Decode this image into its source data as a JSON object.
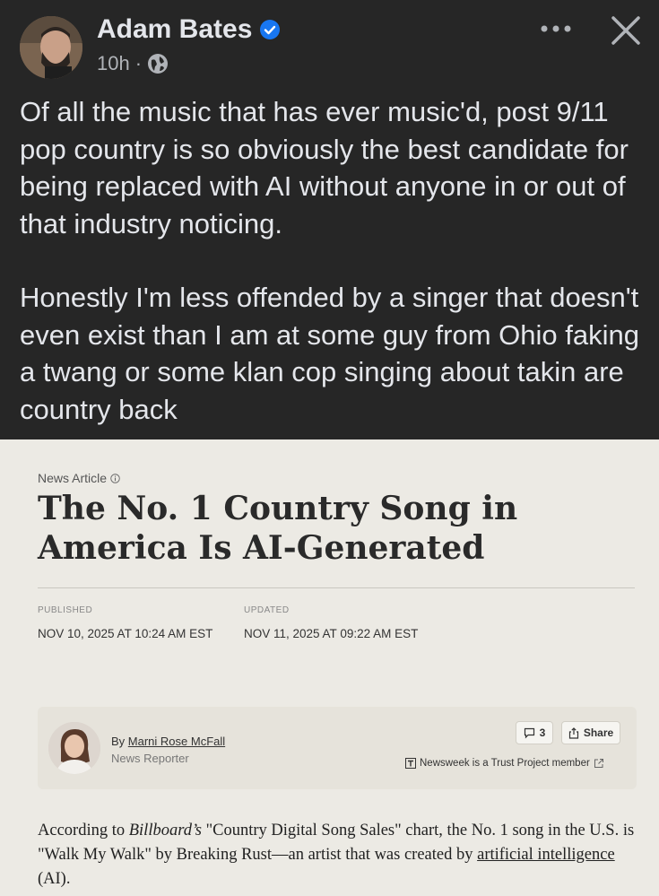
{
  "post": {
    "author": "Adam Bates",
    "time": "10h",
    "separator": "·",
    "paragraphs": [
      "Of all the music that has ever music'd, post 9/11 pop country is so obviously the best candidate for being replaced with AI without anyone in or out of that industry noticing.",
      "Honestly I'm less offended by a singer that doesn't even exist than I am at some guy from Ohio faking a twang or some klan cop singing about takin are country back"
    ],
    "icons": [
      "verified-badge-icon",
      "globe-icon",
      "more-options-icon",
      "close-icon"
    ],
    "colors": {
      "background": "#262626",
      "text": "#e4e6eb",
      "verified": "#1877f2"
    }
  },
  "article": {
    "kicker": "News Article",
    "headline": "The No. 1 Country Song in America Is AI-Generated",
    "published_label": "PUBLISHED",
    "published_date": "NOV 10, 2025 AT 10:24 AM EST",
    "updated_label": "UPDATED",
    "updated_date": "NOV 11, 2025 AT 09:22 AM EST",
    "byline_prefix": "By",
    "author_name": "Marni Rose McFall",
    "author_role": "News Reporter",
    "comment_count": "3",
    "share_label": "Share",
    "trust_text": "Newsweek is a Trust Project member",
    "paragraph": {
      "p1": "According to ",
      "source": "Billboard’s",
      "p2": " \"Country Digital Song Sales\" chart, the No. 1 song in the U.S. is \"Walk My Walk\" by Breaking Rust—an artist that was created by ",
      "link": "artificial intelligence",
      "p3": " (AI)."
    },
    "colors": {
      "background": "#eceae4",
      "author_box": "#e6e3db"
    }
  }
}
